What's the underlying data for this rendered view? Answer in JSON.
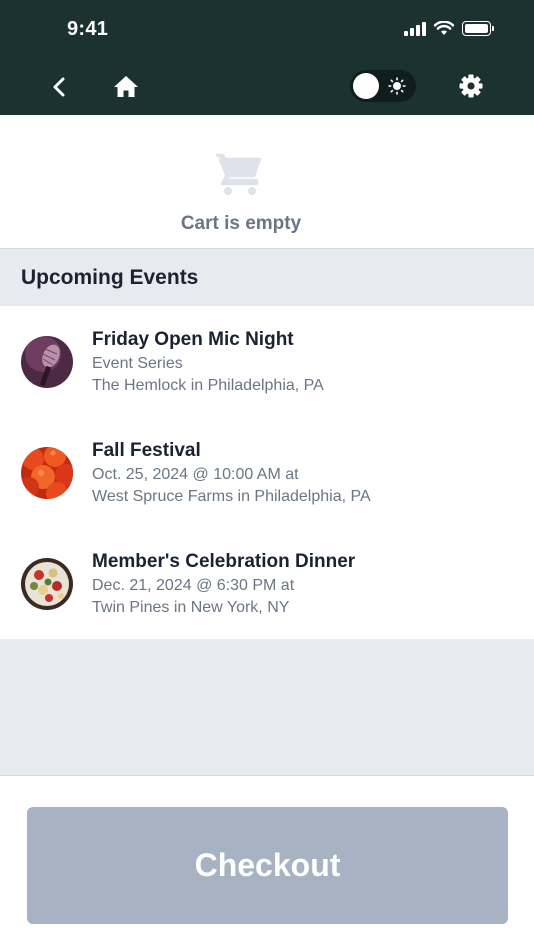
{
  "status_bar": {
    "time": "9:41",
    "icons": [
      "signal-icon",
      "wifi-icon",
      "battery-icon"
    ]
  },
  "nav": {
    "back_icon": "chevron-left-icon",
    "home_icon": "home-icon",
    "theme_toggle": {
      "state": "light",
      "icon": "sun-icon"
    },
    "settings_icon": "gear-icon"
  },
  "cart": {
    "icon": "shopping-cart-icon",
    "empty_text": "Cart is empty"
  },
  "events_section": {
    "title": "Upcoming Events",
    "items": [
      {
        "title": "Friday Open Mic Night",
        "line1": "Event Series",
        "line2": "The Hemlock in Philadelphia, PA",
        "thumbnail": "microphone-photo"
      },
      {
        "title": "Fall Festival",
        "line1": "Oct. 25, 2024 @ 10:00 AM at",
        "line2": "West Spruce Farms in Philadelphia, PA",
        "thumbnail": "tomatoes-photo"
      },
      {
        "title": "Member's Celebration Dinner",
        "line1": "Dec. 21, 2024 @ 6:30 PM at",
        "line2": "Twin Pines in New York, NY",
        "thumbnail": "salad-platter-photo"
      }
    ]
  },
  "footer": {
    "checkout_label": "Checkout"
  },
  "colors": {
    "header_bg": "#1c3230",
    "section_bg": "#e7eaee",
    "muted_text": "#6b7684",
    "checkout_disabled": "#a7b3c2"
  }
}
